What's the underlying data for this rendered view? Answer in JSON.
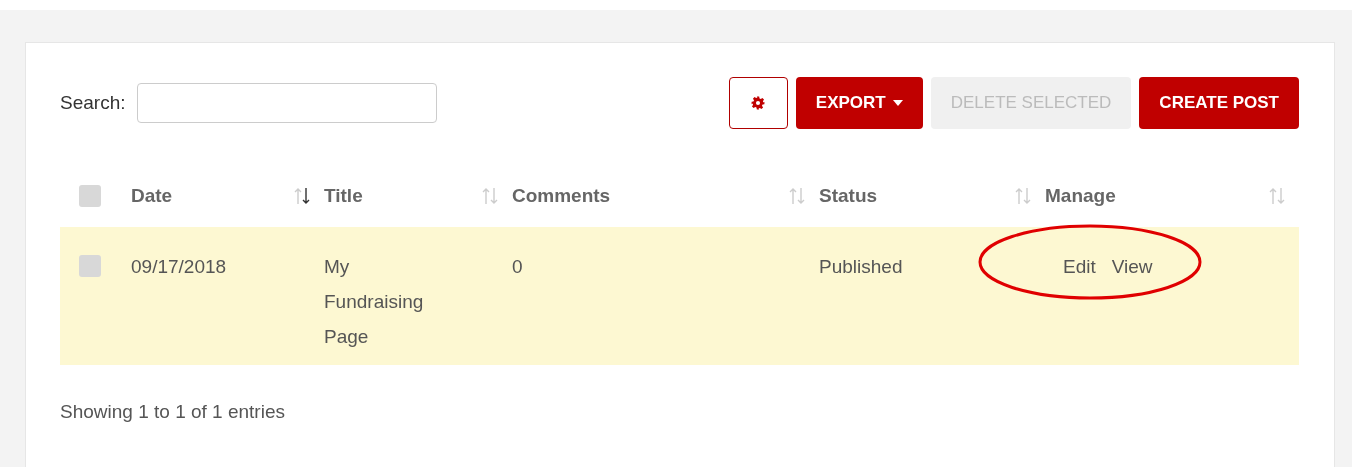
{
  "search": {
    "label": "Search:"
  },
  "toolbar": {
    "settings_button": {
      "kind": "gear"
    },
    "buttons": [
      {
        "label": "EXPORT",
        "kind": "dropdown",
        "disabled": false
      },
      {
        "label": "DELETE SELECTED",
        "kind": "plain",
        "disabled": true
      },
      {
        "label": "CREATE POST",
        "kind": "plain",
        "disabled": false
      }
    ]
  },
  "table": {
    "select_all": {
      "checked": false
    },
    "columns": [
      {
        "label": "Date",
        "sorted": true
      },
      {
        "label": "Title",
        "sorted": false
      },
      {
        "label": "Comments",
        "sorted": false
      },
      {
        "label": "Status",
        "sorted": false
      },
      {
        "label": "Manage",
        "sorted": false
      }
    ],
    "rows": [
      {
        "checked": false,
        "highlighted": true,
        "date": "09/17/2018",
        "title": "My Fundraising Page",
        "comments": "0",
        "status": "Published",
        "actions": [
          "Edit",
          "View"
        ],
        "actions_circled": true
      }
    ]
  },
  "footer": "Showing 1 to 1 of 1 entries"
}
